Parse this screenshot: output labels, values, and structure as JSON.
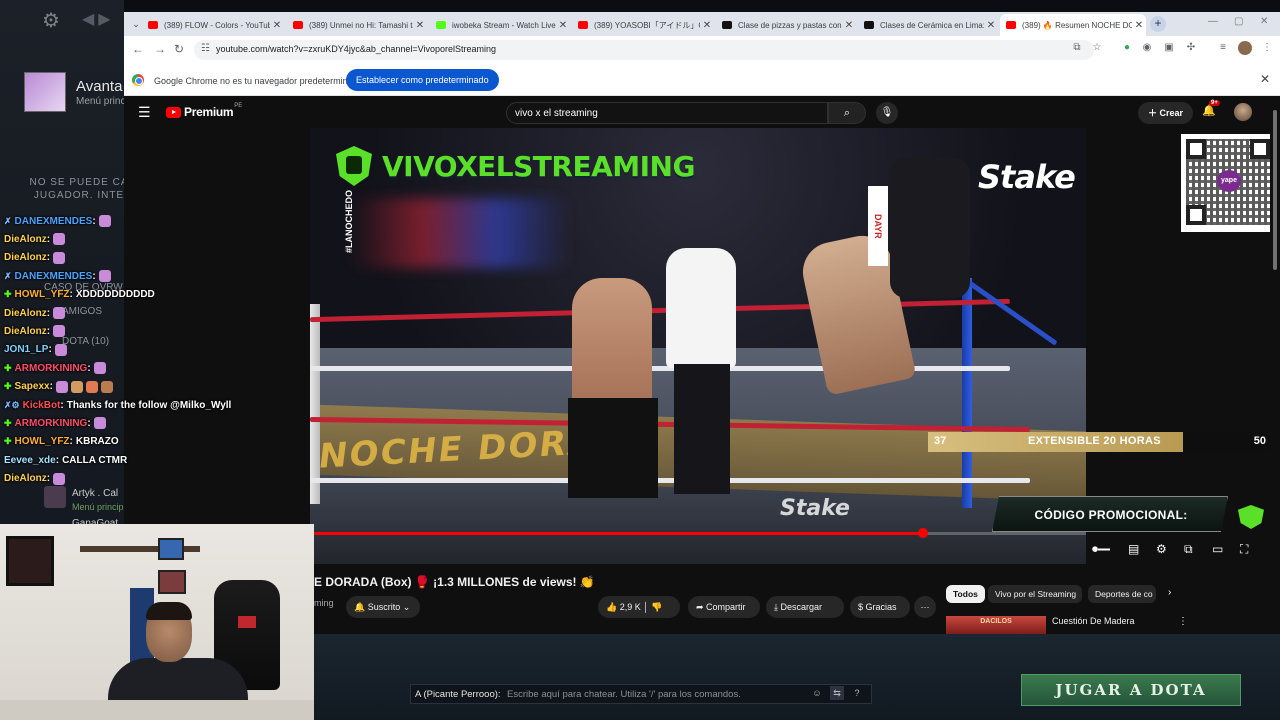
{
  "client": {
    "username": "Avanta",
    "menu": "Menú princi",
    "notice": "NO SE PUEDE CA JUGADOR. INTE",
    "friends_section": "CASO DE OVRW",
    "amigos": "AMIGOS",
    "dota_count": "DOTA (10)",
    "friend1_name": "Artyk . Cal",
    "friend1_sub": "Menú princip",
    "friend2_name": "GanaGoat"
  },
  "browser": {
    "tabs": [
      {
        "title": "(389) FLOW - Colors - YouTube",
        "favicon_color": "#ff0000"
      },
      {
        "title": "(389) Unmei no Hi: Tamashi ta",
        "favicon_color": "#ff0000"
      },
      {
        "title": "iwobeka Stream - Watch Live o",
        "favicon_color": "#53fc18"
      },
      {
        "title": "(389) YOASOBI「アイドル」Officia",
        "favicon_color": "#ff0000"
      },
      {
        "title": "Clase de pizzas y pastas con vi",
        "favicon_color": "#111111"
      },
      {
        "title": "Clases de Cerámica en Lima: U",
        "favicon_color": "#111111"
      },
      {
        "title": "(389) 🔥 Resumen NOCHE DO",
        "favicon_color": "#ff0000"
      }
    ],
    "active_tab_index": 6,
    "url": "youtube.com/watch?v=zxruKDY4jyc&ab_channel=VivoporelStreaming",
    "infobar_message": "Google Chrome no es tu navegador predeterminado",
    "infobar_button": "Establecer como predeterminado"
  },
  "youtube": {
    "logo_text": "Premium",
    "country": "PE",
    "search_query": "vivo x el streaming",
    "create_label": "Crear",
    "notif_count": "9+",
    "video": {
      "brand": "VIVOXELSTREAMING",
      "side_tag": "#LANOCHEDO",
      "sponsor": "Stake",
      "corner_tag": "DAYR",
      "ring_text": "NOCHE DORADA",
      "progress": 0.79
    },
    "title": "E DORADA (Box) 🥊 ¡1.3 MILLONES de views! 👏",
    "channel_fragment": "ming",
    "subscribed_label": "Suscrito",
    "likes": "2,9 K",
    "share_label": "Compartir",
    "download_label": "Descargar",
    "thanks_label": "Gracias",
    "chips": [
      "Todos",
      "Vivo por el Streaming",
      "Deportes de co"
    ],
    "reco_title": "Cuestión De Madera",
    "reco_thumb": "DACILOS"
  },
  "overlay": {
    "qr_label": "yape",
    "subathon_left": "37",
    "subathon_center": "EXTENSIBLE 20 HORAS",
    "subathon_right": "50",
    "subathon_fill": 0.74,
    "promo": "CÓDIGO PROMOCIONAL:"
  },
  "chat": [
    {
      "user": "DANEXMENDES",
      "color": "#4aa3ff",
      "badge": "✗",
      "badge_color": "#7fb7ff",
      "message": "",
      "emotes": 1
    },
    {
      "user": "DieAlonz",
      "color": "#ffd24d",
      "badge": "",
      "badge_color": "",
      "message": "",
      "emotes": 1
    },
    {
      "user": "DieAlonz",
      "color": "#ffd24d",
      "badge": "",
      "badge_color": "",
      "message": "",
      "emotes": 1
    },
    {
      "user": "DANEXMENDES",
      "color": "#4aa3ff",
      "badge": "✗",
      "badge_color": "#7fb7ff",
      "message": "",
      "emotes": 1
    },
    {
      "user": "HOWL_YFZ",
      "color": "#ffb02e",
      "badge": "✚",
      "badge_color": "#53fc18",
      "message": "XDDDDDDDDDD",
      "emotes": 0
    },
    {
      "user": "DieAlonz",
      "color": "#ffd24d",
      "badge": "",
      "badge_color": "",
      "message": "",
      "emotes": 1
    },
    {
      "user": "DieAlonz",
      "color": "#ffd24d",
      "badge": "",
      "badge_color": "",
      "message": "",
      "emotes": 1
    },
    {
      "user": "JON1_LP",
      "color": "#7fd3ff",
      "badge": "",
      "badge_color": "",
      "message": "",
      "emotes": 1
    },
    {
      "user": "ARMORKINING",
      "color": "#ff4d6a",
      "badge": "✚",
      "badge_color": "#53fc18",
      "message": "",
      "emotes": 1
    },
    {
      "user": "Sapexx",
      "color": "#ffd24d",
      "badge": "✚",
      "badge_color": "#53fc18",
      "message": "",
      "emotes": 4
    },
    {
      "user": "KickBot",
      "color": "#ff4d4d",
      "badge": "✗⚙",
      "badge_color": "#7fb7ff",
      "message": "Thanks for the follow @Milko_Wyll",
      "emotes": 0
    },
    {
      "user": "ARMORKINING",
      "color": "#ff4d6a",
      "badge": "✚",
      "badge_color": "#53fc18",
      "message": "",
      "emotes": 1
    },
    {
      "user": "HOWL_YFZ",
      "color": "#ffb02e",
      "badge": "✚",
      "badge_color": "#53fc18",
      "message": "KBRAZO",
      "emotes": 0
    },
    {
      "user": "Eevee_xde",
      "color": "#a6e3ff",
      "badge": "",
      "badge_color": "",
      "message": "CALLA CTMR",
      "emotes": 0
    },
    {
      "user": "DieAlonz",
      "color": "#ffd24d",
      "badge": "",
      "badge_color": "",
      "message": "",
      "emotes": 1
    }
  ],
  "gamechat": {
    "channel": "A (Picante Perrooo):",
    "placeholder": "Escribe aquí para chatear. Utiliza '/' para los comandos.",
    "play_button": "JUGAR A DOTA"
  }
}
